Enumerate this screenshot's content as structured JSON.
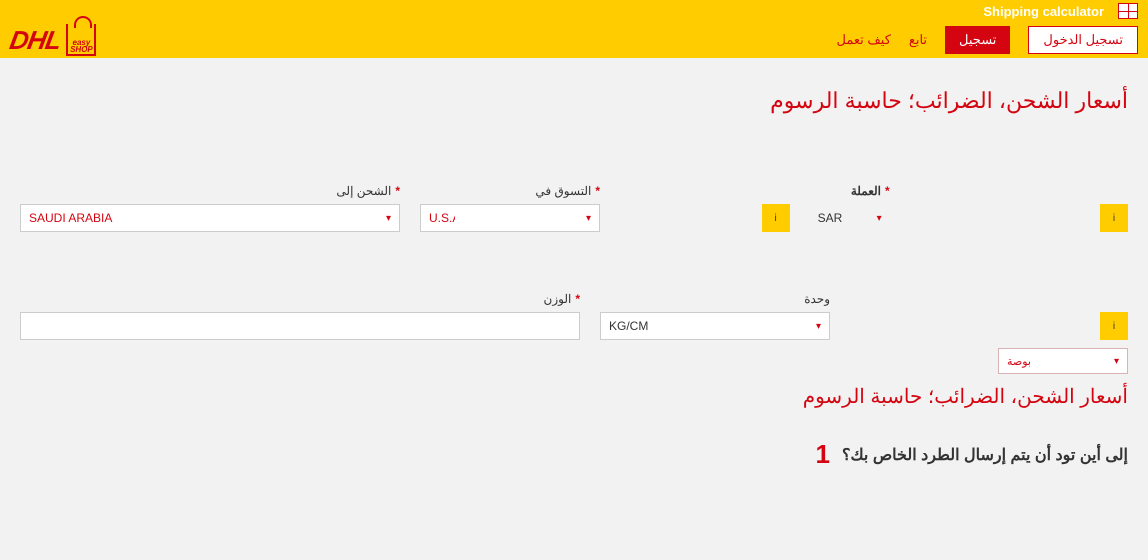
{
  "topbar": {
    "title": "Shipping calculator"
  },
  "logo": {
    "brand": "DHL",
    "sub1": "easy",
    "sub2": "SHOP"
  },
  "nav": {
    "how_it_works": "كيف تعمل",
    "follow": "تابع",
    "register": "تسجيل",
    "login": "تسجيل الدخول"
  },
  "page_title": "أسعار الشحن، الضرائب؛ حاسبة الرسوم",
  "fields": {
    "ship_to": {
      "label": "الشحن إلى",
      "value": "SAUDI ARABIA"
    },
    "shop_in": {
      "label": "التسوق في",
      "value": "U.S.A"
    },
    "currency": {
      "label": "العملة",
      "value": "SAR"
    },
    "weight": {
      "label": "الوزن",
      "value": ""
    },
    "unit": {
      "label": "وحدة",
      "value": "KG/CM"
    },
    "inch": {
      "value": "بوصة"
    }
  },
  "info_label": "i",
  "section2_title": "أسعار الشحن، الضرائب؛ حاسبة الرسوم",
  "step1": {
    "num": "1",
    "text": "إلى أين تود أن يتم إرسال الطرد الخاص بك؟"
  }
}
